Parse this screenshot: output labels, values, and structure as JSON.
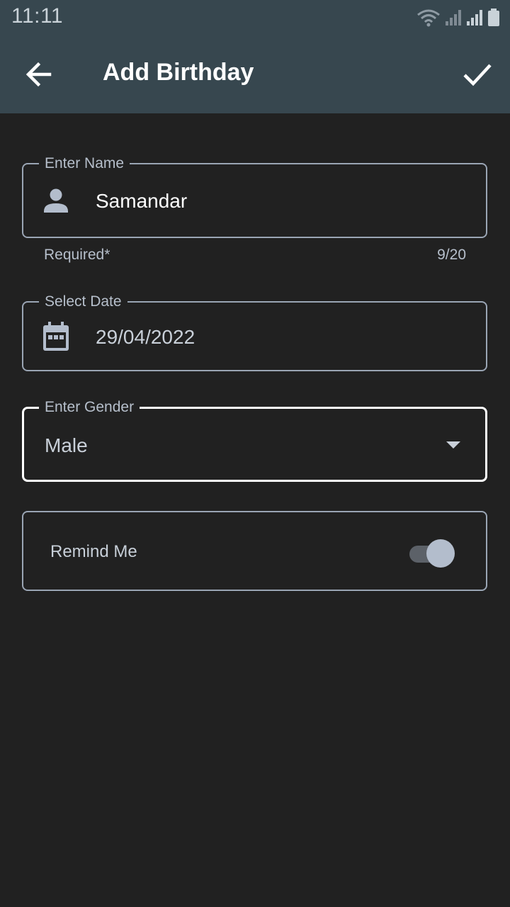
{
  "status_bar": {
    "time": "11:11",
    "icons": [
      "wifi-icon",
      "signal-icon",
      "signal-icon",
      "battery-icon"
    ]
  },
  "app_bar": {
    "title": "Add Birthday",
    "back_icon": "arrow-left-icon",
    "confirm_icon": "check-icon",
    "color": "#37474f"
  },
  "form": {
    "name": {
      "label": "Enter Name",
      "value": "Samandar",
      "helper": "Required*",
      "counter": "9/20",
      "icon": "person-icon"
    },
    "date": {
      "label": "Select Date",
      "value": "29/04/2022",
      "icon": "calendar-icon"
    },
    "gender": {
      "label": "Enter Gender",
      "value": "Male",
      "icon": "dropdown-arrow-icon"
    },
    "remind": {
      "label": "Remind Me",
      "enabled": true
    }
  },
  "colors": {
    "background": "#212121",
    "outline": "#9aa5b4",
    "focused_outline": "#ffffff",
    "accent": "#b3bdcc"
  }
}
